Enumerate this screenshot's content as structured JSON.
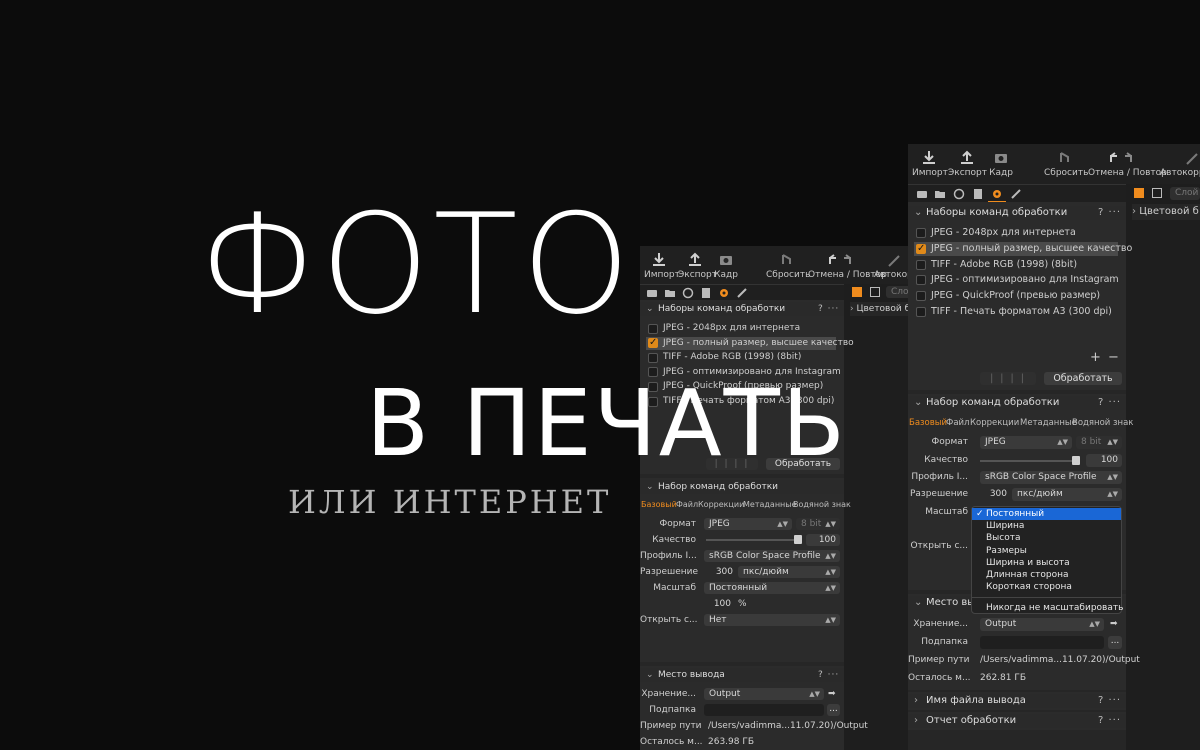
{
  "headline": {
    "line1": "ФОТО",
    "line2": "В ПЕЧАТЬ",
    "line3": "ИЛИ ИНТЕРНЕТ"
  },
  "colors": {
    "accent": "#f08c1e",
    "menu_selected": "#1a67d6",
    "background": "#0c0c0c"
  },
  "toolbar": {
    "import": "Импорт",
    "export": "Экспорт",
    "crop": "Кадр",
    "reset": "Сбросить",
    "undo_redo": "Отмена / Повтор",
    "auto": "Автокорре"
  },
  "side_tabs": {
    "layer": "Слой",
    "color_balance": "Цветовой б"
  },
  "recipes_panel": {
    "title": "Наборы команд обработки",
    "help": "? ···",
    "items": [
      {
        "label": "JPEG - 2048px для интернета",
        "checked": false
      },
      {
        "label": "JPEG - полный размер, высшее качество",
        "checked": true
      },
      {
        "label": "TIFF - Adobe RGB (1998) (8bit)",
        "checked": false
      },
      {
        "label": "JPEG - оптимизировано для Instagram",
        "checked": false
      },
      {
        "label": "JPEG - QuickProof (превью размер)",
        "checked": false
      },
      {
        "label": "TIFF - Печать форматом А3 (300 dpi)",
        "checked": false
      }
    ],
    "process_button": "Обработать",
    "add": "+",
    "remove": "−"
  },
  "recipe_panel": {
    "title": "Набор команд обработки",
    "tabs": [
      "Базовый",
      "Файл",
      "Коррекции",
      "Метаданные",
      "Водяной знак"
    ],
    "format_label": "Формат",
    "format_value": "JPEG",
    "bit_value": "8 bit",
    "quality_label": "Качество",
    "quality_value": 100,
    "profile_label": "Профиль I...",
    "profile_value": "sRGB Color Space Profile",
    "resolution_label": "Разрешение",
    "resolution_value": "300",
    "resolution_unit": "пкс/дюйм",
    "scale_label": "Масштаб",
    "scale_value": "Постоянный",
    "scale_percent": "100",
    "percent_sign": "%",
    "open_with_label": "Открыть с...",
    "open_with_value": "Нет"
  },
  "scale_menu": {
    "items": [
      "Постоянный",
      "Ширина",
      "Высота",
      "Размеры",
      "Ширина и высота",
      "Длинная сторона",
      "Короткая сторона"
    ],
    "selected": "Постоянный",
    "footer": "Никогда не масштабировать"
  },
  "output_panel": {
    "title": "Место вывода",
    "title_truncated": "Место вы",
    "storage_label": "Хранение...",
    "storage_value": "Output",
    "folder_label": "Подпапка",
    "folder_button": "...",
    "path_label": "Пример пути",
    "path_value": "/Users/vadimma...11.07.20)/Output",
    "free_label": "Осталось м...",
    "free_value_back": "263.98 ГБ",
    "free_value_front": "262.81 ГБ"
  },
  "filename_panel": {
    "title": "Имя файла вывода"
  },
  "report_panel": {
    "title": "Отчет обработки"
  }
}
